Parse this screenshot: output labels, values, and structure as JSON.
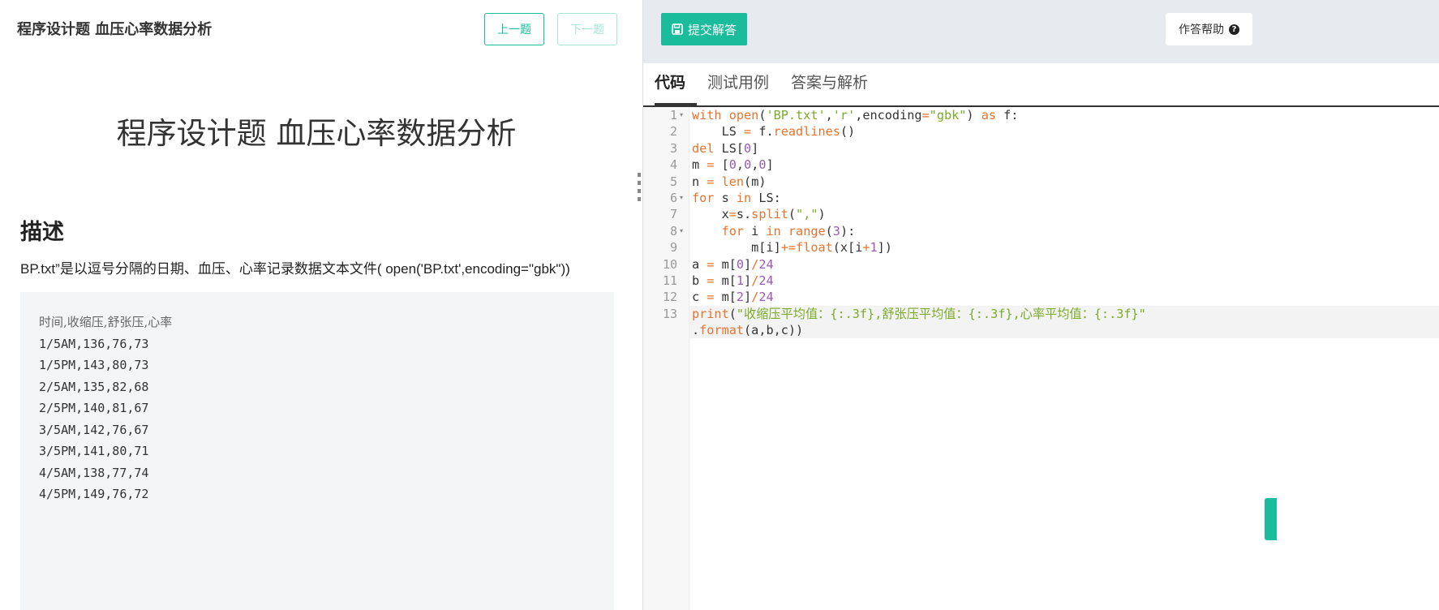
{
  "header": {
    "title": "程序设计题 血压心率数据分析",
    "prev_label": "上一题",
    "next_label": "下一题"
  },
  "problem": {
    "title": "程序设计题 血压心率数据分析",
    "desc_heading": "描述",
    "desc_text": "BP.txt”是以逗号分隔的日期、血压、心率记录数据文本文件( open('BP.txt',encoding=\"gbk\"))",
    "sample_lines": [
      "时间,收缩压,舒张压,心率",
      "1/5AM,136,76,73",
      "1/5PM,143,80,73",
      "2/5AM,135,82,68",
      "2/5PM,140,81,67",
      "3/5AM,142,76,67",
      "3/5PM,141,80,71",
      "4/5AM,138,77,74",
      "4/5PM,149,76,72"
    ]
  },
  "toolbar": {
    "submit_label": "提交解答",
    "help_label": "作答帮助"
  },
  "tabs": [
    {
      "label": "代码",
      "active": true
    },
    {
      "label": "测试用例",
      "active": false
    },
    {
      "label": "答案与解析",
      "active": false
    }
  ],
  "editor": {
    "line_numbers": [
      "1",
      "2",
      "3",
      "4",
      "5",
      "6",
      "7",
      "8",
      "9",
      "10",
      "11",
      "12",
      "13"
    ],
    "code_lines": [
      "with open('BP.txt','r',encoding=\"gbk\") as f:",
      "    LS = f.readlines()",
      "del LS[0]",
      "m = [0,0,0]",
      "n = len(m)",
      "for s in LS:",
      "    x=s.split(\",\")",
      "    for i in range(3):",
      "        m[i]+=float(x[i+1])",
      "a = m[0]/24",
      "b = m[1]/24",
      "c = m[2]/24",
      "print(\"收缩压平均值：{:.3f},舒张压平均值：{:.3f},心率平均值：{:.3f}\"",
      ".format(a,b,c))"
    ]
  },
  "colors": {
    "accent": "#1abc9c",
    "keyword": "#e4742f",
    "string": "#7bab2b",
    "number": "#9b59b6"
  }
}
